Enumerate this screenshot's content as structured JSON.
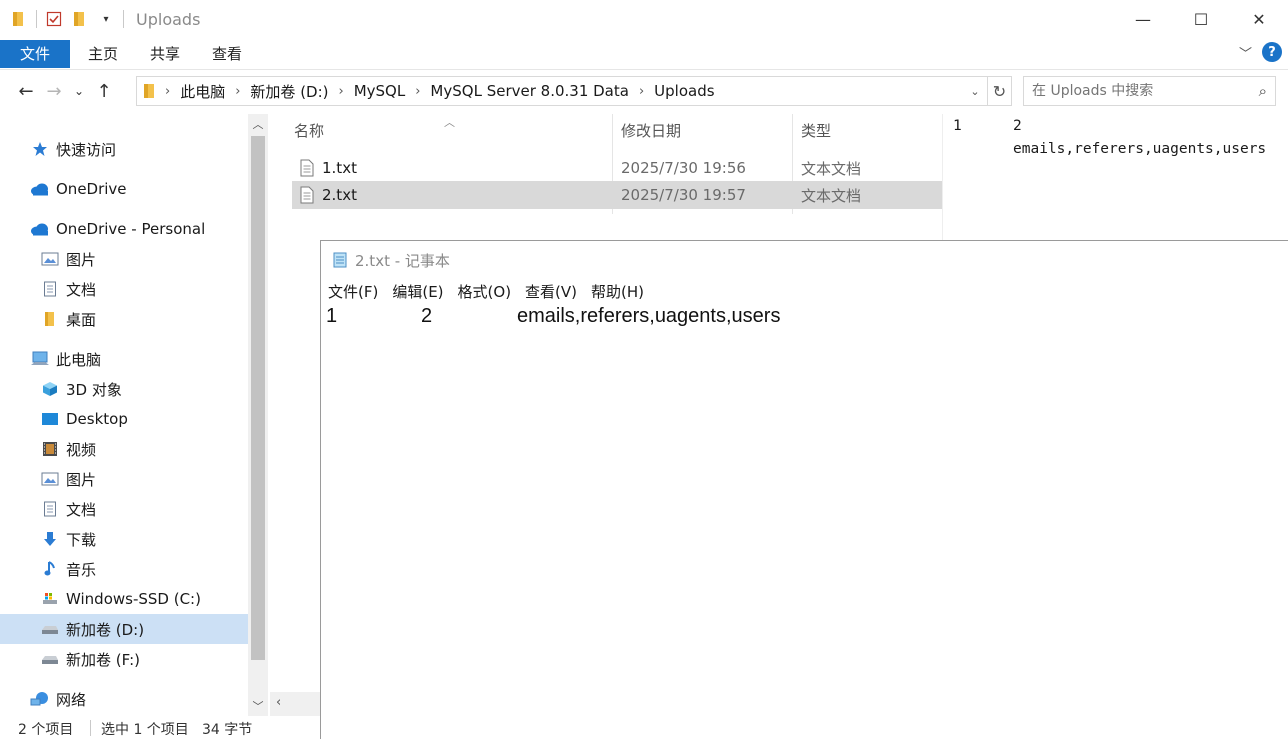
{
  "window": {
    "title": "Uploads",
    "controls": {
      "minimize": "—",
      "maximize": "☐",
      "close": "✕"
    }
  },
  "ribbon": {
    "tabs": [
      "文件",
      "主页",
      "共享",
      "查看"
    ],
    "help": "?"
  },
  "address": {
    "crumbs": [
      "此电脑",
      "新加卷 (D:)",
      "MySQL",
      "MySQL Server 8.0.31 Data",
      "Uploads"
    ],
    "search_placeholder": "在 Uploads 中搜索"
  },
  "navpane": {
    "items": [
      {
        "label": "快速访问",
        "icon": "star-icon"
      },
      {
        "label": "OneDrive",
        "icon": "cloud-icon"
      },
      {
        "label": "OneDrive - Personal",
        "icon": "cloud-icon"
      },
      {
        "label": "图片",
        "icon": "picture-icon"
      },
      {
        "label": "文档",
        "icon": "document-icon"
      },
      {
        "label": "桌面",
        "icon": "folder-icon"
      },
      {
        "label": "此电脑",
        "icon": "computer-icon"
      },
      {
        "label": "3D 对象",
        "icon": "cube-icon"
      },
      {
        "label": "Desktop",
        "icon": "desktop-icon"
      },
      {
        "label": "视频",
        "icon": "film-icon"
      },
      {
        "label": "图片",
        "icon": "picture-icon"
      },
      {
        "label": "文档",
        "icon": "document-icon"
      },
      {
        "label": "下载",
        "icon": "download-icon"
      },
      {
        "label": "音乐",
        "icon": "music-icon"
      },
      {
        "label": "Windows-SSD (C:)",
        "icon": "drive-icon"
      },
      {
        "label": "新加卷 (D:)",
        "icon": "drive-icon"
      },
      {
        "label": "新加卷 (F:)",
        "icon": "drive-icon"
      },
      {
        "label": "网络",
        "icon": "network-icon"
      }
    ]
  },
  "filelist": {
    "columns": [
      "名称",
      "修改日期",
      "类型"
    ],
    "rows": [
      {
        "name": "1.txt",
        "modified": "2025/7/30 19:56",
        "type": "文本文档"
      },
      {
        "name": "2.txt",
        "modified": "2025/7/30 19:57",
        "type": "文本文档"
      }
    ]
  },
  "preview": {
    "col1": "1",
    "col2": "2",
    "col3": "emails,referers,uagents,users"
  },
  "status": {
    "count": "2 个项目",
    "selected": "选中 1 个项目",
    "size": "34 字节"
  },
  "notepad": {
    "title": "2.txt - 记事本",
    "menu": [
      "文件(F)",
      "编辑(E)",
      "格式(O)",
      "查看(V)",
      "帮助(H)"
    ],
    "text": {
      "col1": "1",
      "col2": "2",
      "col3": "emails,referers,uagents,users"
    }
  },
  "colors": {
    "accent": "#1a73c8",
    "selection": "#cce0f5",
    "row_selected": "#d9d9d9"
  }
}
